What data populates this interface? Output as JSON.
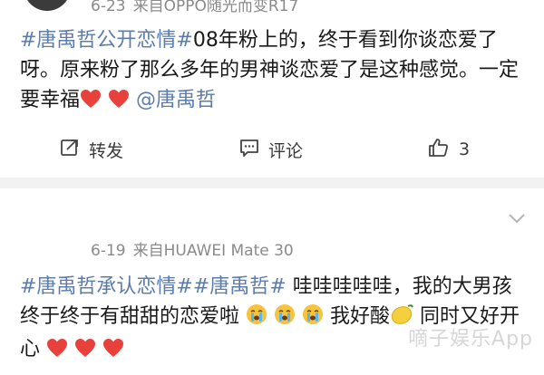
{
  "post1": {
    "meta_time": "6-23",
    "meta_source": "来自OPPO随光而变R17",
    "tag1": "#唐禹哲公开恋情#",
    "text": "08年粉上的，终于看到你谈恋爱了呀。原来粉了那么多年的男神谈恋爱了是这种感觉。一定要幸福",
    "mention": "@唐禹哲",
    "actions": {
      "repost": "转发",
      "comment": "评论",
      "like_count": "3"
    }
  },
  "post2": {
    "meta_time": "6-19",
    "meta_source": "来自HUAWEI Mate 30",
    "tag1": "#唐禹哲承认恋情#",
    "tag2": "#唐禹哲#",
    "text1": " 哇哇哇哇哇，我的大男孩终于终于有甜甜的恋爱啦",
    "text2": "我好酸",
    "text3": " 同时又好开心"
  },
  "watermark": "嘀子娱乐App",
  "colors": {
    "tag": "#5b7cad",
    "heart": "#e8413b",
    "separator": "#f2f2f2"
  }
}
